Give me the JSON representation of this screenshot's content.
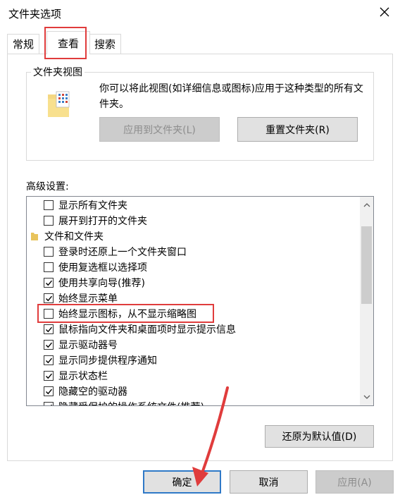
{
  "window": {
    "title": "文件夹选项"
  },
  "tabs": [
    {
      "label": "常规"
    },
    {
      "label": "查看"
    },
    {
      "label": "搜索"
    }
  ],
  "folder_views": {
    "group_label": "文件夹视图",
    "description": "你可以将此视图(如详细信息或图标)应用于这种类型的所有文件夹。",
    "apply_button": "应用到文件夹(L)",
    "reset_button": "重置文件夹(R)"
  },
  "advanced": {
    "label": "高级设置:",
    "items": [
      {
        "label": "显示所有文件夹",
        "kind": "checkbox",
        "checked": false
      },
      {
        "label": "展开到打开的文件夹",
        "kind": "checkbox",
        "checked": false
      },
      {
        "label": "文件和文件夹",
        "kind": "folder"
      },
      {
        "label": "登录时还原上一个文件夹窗口",
        "kind": "checkbox",
        "checked": false
      },
      {
        "label": "使用复选框以选择项",
        "kind": "checkbox",
        "checked": false
      },
      {
        "label": "使用共享向导(推荐)",
        "kind": "checkbox",
        "checked": true
      },
      {
        "label": "始终显示菜单",
        "kind": "checkbox",
        "checked": true
      },
      {
        "label": "始终显示图标，从不显示缩略图",
        "kind": "checkbox",
        "checked": false
      },
      {
        "label": "鼠标指向文件夹和桌面项时显示提示信息",
        "kind": "checkbox",
        "checked": true
      },
      {
        "label": "显示驱动器号",
        "kind": "checkbox",
        "checked": true
      },
      {
        "label": "显示同步提供程序通知",
        "kind": "checkbox",
        "checked": true
      },
      {
        "label": "显示状态栏",
        "kind": "checkbox",
        "checked": true
      },
      {
        "label": "隐藏空的驱动器",
        "kind": "checkbox",
        "checked": true
      },
      {
        "label": "隐藏受保护的操作系统文件(推荐)",
        "kind": "checkbox",
        "checked": true
      }
    ],
    "restore_defaults_button": "还原为默认值(D)"
  },
  "footer": {
    "ok_button": "确定",
    "cancel_button": "取消",
    "apply_button": "应用(A)"
  },
  "colors": {
    "annotation_red": "#e03c3c",
    "default_button_border": "#2f79c7"
  }
}
